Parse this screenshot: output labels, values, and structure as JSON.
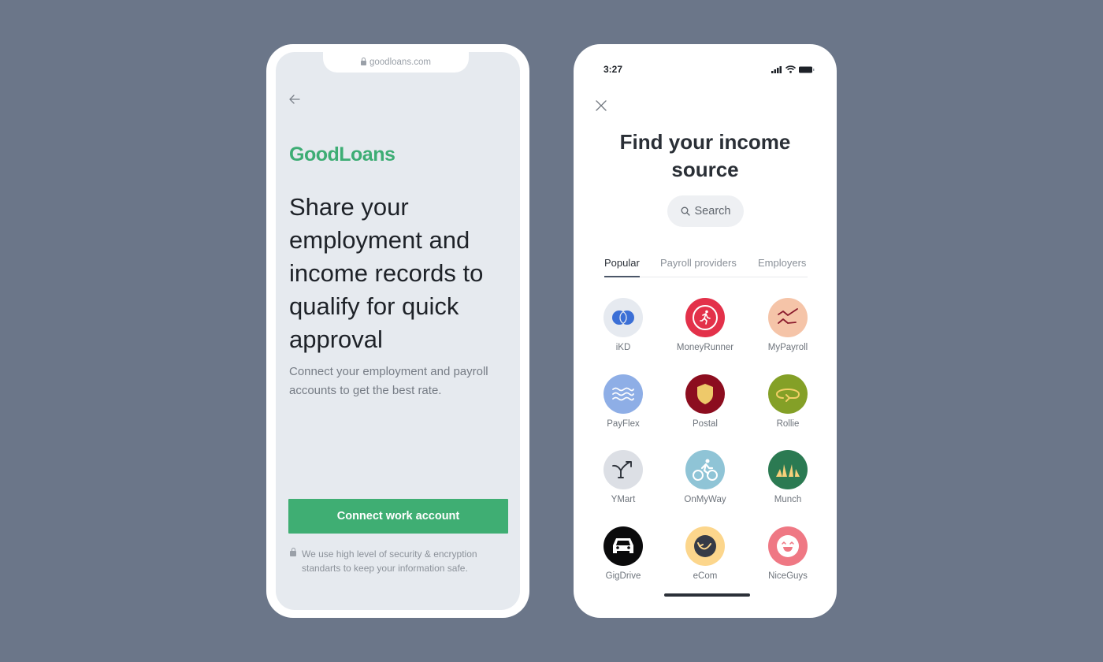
{
  "left_phone": {
    "url": "goodloans.com",
    "back_icon": "arrow-left-icon",
    "brand_logo": "GoodLoans",
    "headline": "Share your employment and income records to qualify for quick approval",
    "subtext": "Connect your employment and payroll accounts to get the best rate.",
    "cta_label": "Connect work account",
    "security_note": "We use high level of security & encryption standarts to keep your information safe.",
    "colors": {
      "brand": "#3dad74",
      "cta": "#3fae73",
      "screen_bg": "#e6eaef"
    }
  },
  "right_phone": {
    "status_time": "3:27",
    "close_icon": "close-icon",
    "title": "Find your income source",
    "search_placeholder": "Search",
    "tabs": [
      {
        "label": "Popular",
        "active": true
      },
      {
        "label": "Payroll providers",
        "active": false
      },
      {
        "label": "Employers",
        "active": false
      }
    ],
    "providers": [
      {
        "name": "iKD",
        "icon": "overlap-circles-icon",
        "bg": "#e6eaf0"
      },
      {
        "name": "MoneyRunner",
        "icon": "runner-icon",
        "bg": "#e3314a"
      },
      {
        "name": "MyPayroll",
        "icon": "zigzag-icon",
        "bg": "#f5c4a8"
      },
      {
        "name": "PayFlex",
        "icon": "waves-icon",
        "bg": "#8eaee6"
      },
      {
        "name": "Postal",
        "icon": "shield-icon",
        "bg": "#8c0d1f"
      },
      {
        "name": "Rollie",
        "icon": "rotate-arrow-icon",
        "bg": "#84a027"
      },
      {
        "name": "YMart",
        "icon": "split-arrow-icon",
        "bg": "#dcdfe5"
      },
      {
        "name": "OnMyWay",
        "icon": "cyclist-icon",
        "bg": "#8fc4d6"
      },
      {
        "name": "Munch",
        "icon": "croissant-icon",
        "bg": "#2b7a52"
      },
      {
        "name": "GigDrive",
        "icon": "car-icon",
        "bg": "#0b0b0c"
      },
      {
        "name": "eCom",
        "icon": "smile-arrow-icon",
        "bg": "#fcd68c"
      },
      {
        "name": "NiceGuys",
        "icon": "happy-face-icon",
        "bg": "#ef7884"
      }
    ]
  }
}
